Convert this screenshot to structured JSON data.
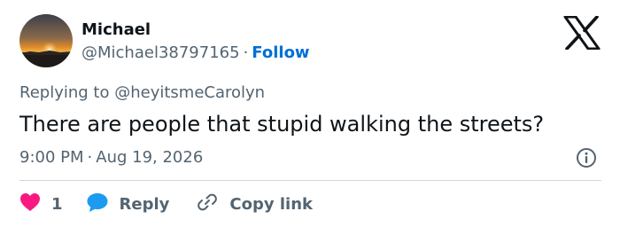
{
  "author": {
    "name": "Michael",
    "handle": "@Michael38797165",
    "separator": "·",
    "follow_label": "Follow"
  },
  "reply_context": {
    "prefix": "Replying to",
    "mention": "@heyitsmeCarolyn"
  },
  "tweet": {
    "text": "There are people that stupid walking the streets?",
    "time": "9:00 PM",
    "separator": "·",
    "date": "Aug 19, 2026"
  },
  "actions": {
    "like_count": "1",
    "reply_label": "Reply",
    "copy_link_label": "Copy link"
  },
  "icons": {
    "brand": "x-logo-icon",
    "info": "info-icon",
    "like": "heart-icon",
    "reply": "speech-bubble-icon",
    "copy": "link-icon"
  },
  "colors": {
    "like": "#f91880",
    "reply": "#1d9bf0",
    "follow": "#006fd6",
    "secondary_text": "#536471",
    "primary_text": "#0f1419"
  }
}
